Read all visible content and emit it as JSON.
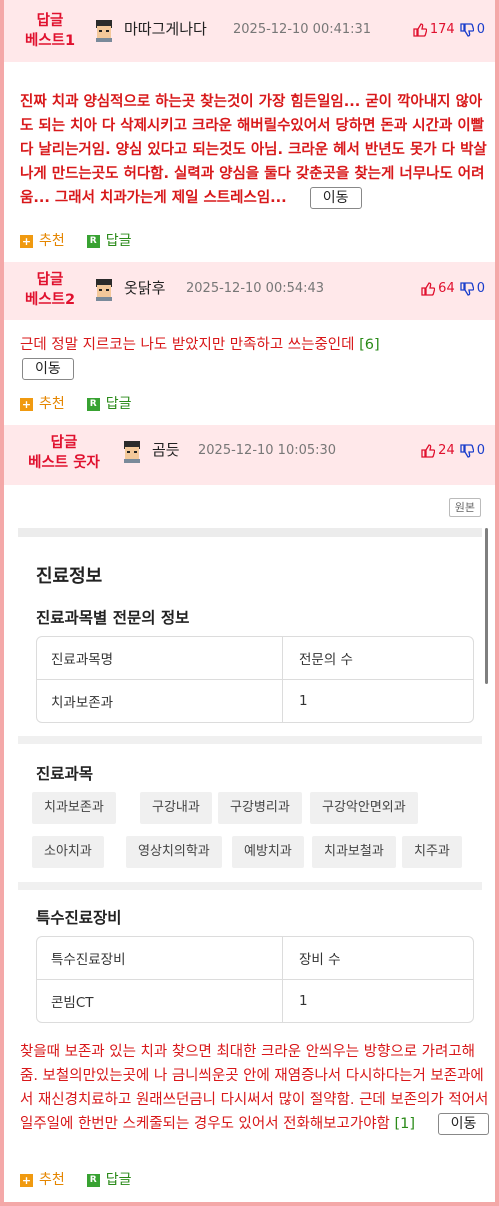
{
  "comments": [
    {
      "badge": "답글\n베스트1",
      "nick": "마따그게나다",
      "date": "2025-12-10 00:41:31",
      "up": "174",
      "down": "0",
      "text": "진짜 치과 양심적으로 하는곳 찾는것이 가장 힘든일임... 굳이 깍아내지 않아도 되는 치아 다 삭제시키고 크라운 해버릴수있어서 당하면 돈과 시간과 이빨 다 날리는거임. 양심 있다고 되는것도 아님. 크라운 헤서 반년도 못가 다 박살나게 만드는곳도 허다함. 실력과 양심을 둘다 갖춘곳을 찾는게 너무나도 어려움... 그래서 치과가는게 제일 스트레스임...",
      "move": "이동"
    },
    {
      "badge": "답글\n베스트2",
      "nick": "옷닭후",
      "date": "2025-12-10 00:54:43",
      "up": "64",
      "down": "0",
      "text": "근데 정말 지르코는 나도 받았지만 만족하고 쓰는중인데",
      "reply_count": "[6]",
      "move": "이동"
    },
    {
      "badge": "답글\n베스트 웃자",
      "nick": "곰듯",
      "date": "2025-12-10 10:05:30",
      "up": "24",
      "down": "0",
      "original": "원본",
      "text": "찾을때 보존과 있는 치과 찾으면 최대한 크라운 안씌우는 방향으로 가려고해줌. 보철의만있는곳에 나 금니씌운곳 안에 재염증나서 다시하다는거 보존과에서 재신경치료하고 원래쓰던금니 다시써서 많이 절약함. 근데 보존의가 적어서 일주일에 한번만 스케줄되는 경우도 있어서 전화해보고가야함",
      "reply_count": "[1]",
      "move": "이동"
    }
  ],
  "actions": {
    "recommend": "추천",
    "reply": "답글",
    "reply_icon": "R"
  },
  "embed": {
    "title": "진료정보",
    "section1": "진료과목별 전문의 정보",
    "table1": {
      "headers": [
        "진료과목명",
        "전문의 수"
      ],
      "rows": [
        [
          "치과보존과",
          "1"
        ]
      ]
    },
    "section2": "진료과목",
    "departments": [
      "치과보존과",
      "구강내과",
      "구강병리과",
      "구강악안면외과",
      "소아치과",
      "영상치의학과",
      "예방치과",
      "치과보철과",
      "치주과"
    ],
    "section3": "특수진료장비",
    "table2": {
      "headers": [
        "특수진료장비",
        "장비 수"
      ],
      "rows": [
        [
          "콘빔CT",
          "1"
        ]
      ]
    }
  },
  "colors": {
    "badge": "#e0102e",
    "body_text": "#d8181a",
    "header_bg": "#ffe8ea",
    "border": "#f4a8a8",
    "up": "#e0102e",
    "down": "#1a3ecc"
  },
  "icons": [
    "thumbs-up-icon",
    "thumbs-down-icon",
    "plus-icon",
    "reply-r-icon",
    "avatar-icon"
  ]
}
